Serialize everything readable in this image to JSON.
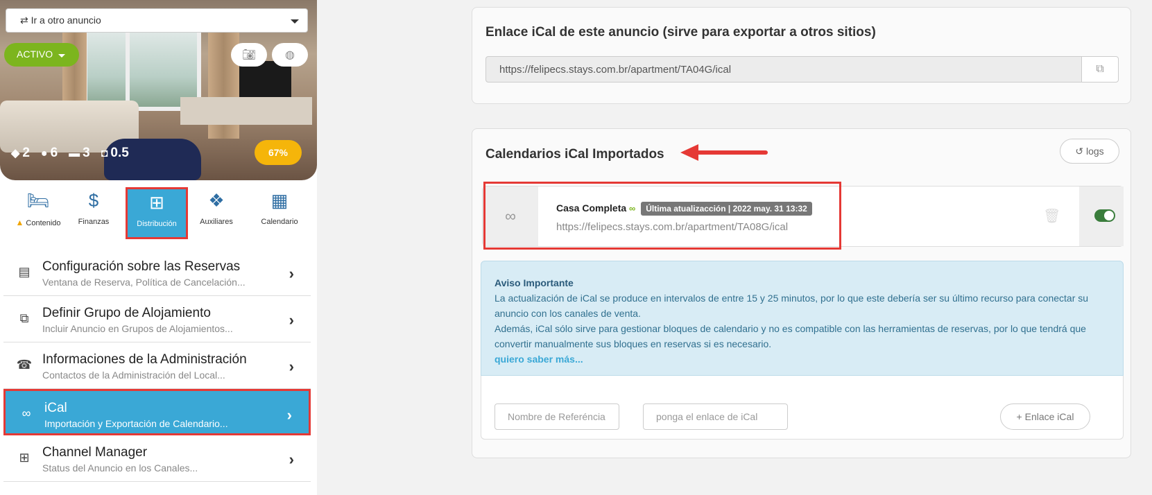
{
  "hero": {
    "goto_label": "⇄ Ir a otro anuncio",
    "status_label": "ACTIVO",
    "stats": [
      {
        "icon": "box-icon",
        "value": "2"
      },
      {
        "icon": "user-icon",
        "value": "6"
      },
      {
        "icon": "bed-icon",
        "value": "3"
      },
      {
        "icon": "bath-icon",
        "value": "0.5"
      }
    ],
    "completion": "67%"
  },
  "tabs": [
    {
      "label": "Contenido",
      "icon": "bed-icon"
    },
    {
      "label": "Finanzas",
      "icon": "dollar-icon"
    },
    {
      "label": "Distribución",
      "icon": "sitemap-icon"
    },
    {
      "label": "Auxiliares",
      "icon": "cubes-icon"
    },
    {
      "label": "Calendario",
      "icon": "calendar-icon"
    }
  ],
  "menu": [
    {
      "title": "Configuración sobre las Reservas",
      "subtitle": "Ventana de Reserva, Política de Cancelación...",
      "icon": "calendar-check-icon"
    },
    {
      "title": "Definir Grupo de Alojamiento",
      "subtitle": "Incluir Anuncio en Grupos de Alojamientos...",
      "icon": "group-icon"
    },
    {
      "title": "Informaciones de la Administración",
      "subtitle": "Contactos de la Administración del Local...",
      "icon": "phone-icon"
    },
    {
      "title": "iCal",
      "subtitle": "Importación y Exportación de Calendario...",
      "icon": "link-icon"
    },
    {
      "title": "Channel Manager",
      "subtitle": "Status del Anuncio en los Canales...",
      "icon": "sitemap-icon"
    }
  ],
  "export_panel": {
    "title": "Enlace iCal de este anuncio (sirve para exportar a otros sitios)",
    "url": "https://felipecs.stays.com.br/apartment/TA04G/ical"
  },
  "import_panel": {
    "title": "Calendarios iCal Importados",
    "logs_label": "logs",
    "calendar": {
      "name": "Casa Completa",
      "badge": "Última atualizacción | 2022 may. 31 13:32",
      "url": "https://felipecs.stays.com.br/apartment/TA08G/ical",
      "enabled": true
    },
    "notice": {
      "title": "Aviso Importante",
      "line1": "La actualización de iCal se produce en intervalos de entre 15 y 25 minutos, por lo que este debería ser su último recurso para conectar su anuncio con los canales de venta.",
      "line2": "Además, iCal sólo sirve para gestionar bloques de calendario y no es compatible con las herramientas de reservas, por lo que tendrá que convertir manualmente sus bloques en reservas si es necesario.",
      "more": "quiero saber más..."
    },
    "add": {
      "name_placeholder": "Nombre de Referéncia",
      "url_placeholder": "ponga el enlace de iCal",
      "button_label": "+ Enlace iCal"
    }
  },
  "colors": {
    "accent": "#3aa8d6",
    "active_green": "#7cb51e",
    "highlight_red": "#e53935",
    "badge_orange": "#f5b50a"
  }
}
